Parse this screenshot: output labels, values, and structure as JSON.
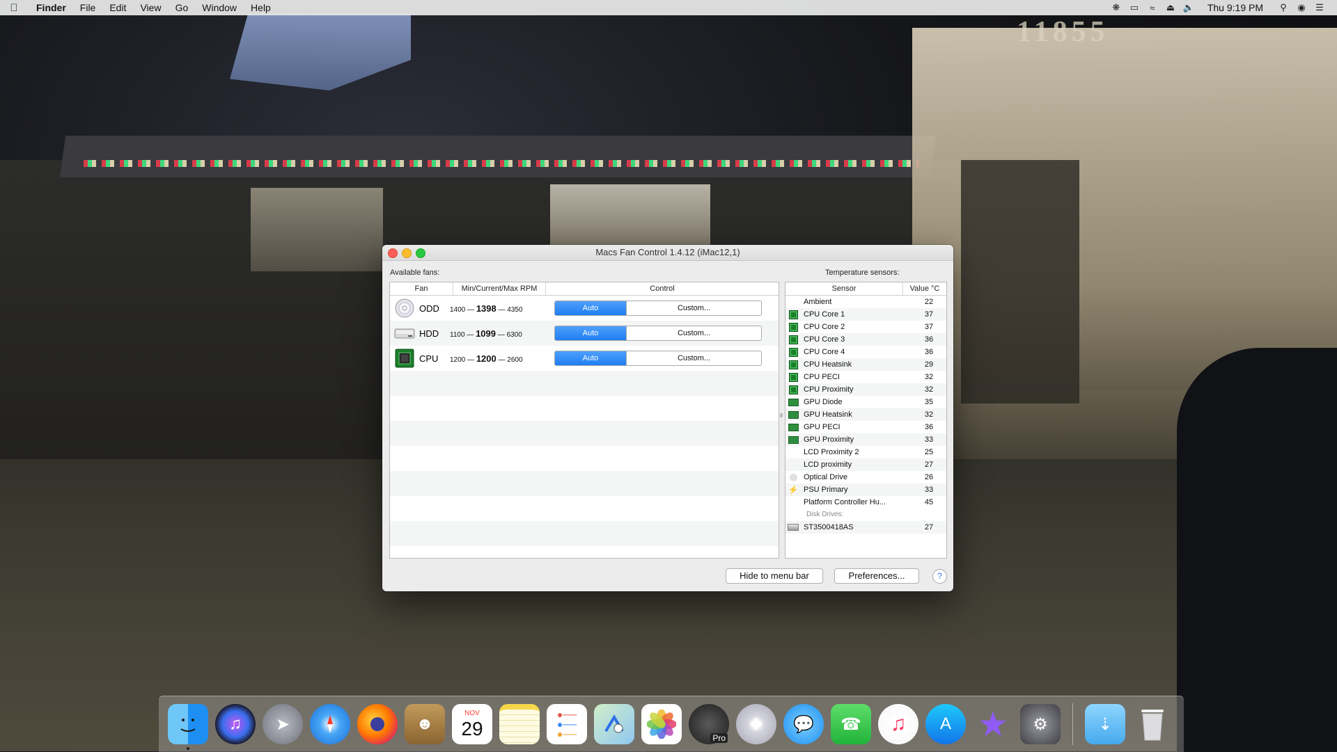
{
  "menubar": {
    "app_name": "Finder",
    "menus": [
      "File",
      "Edit",
      "View",
      "Go",
      "Window",
      "Help"
    ],
    "clock": "Thu 9:19 PM"
  },
  "window": {
    "title": "Macs Fan Control 1.4.12 (iMac12,1)",
    "fans_label": "Available fans:",
    "sensors_label": "Temperature sensors:",
    "fan_headers": {
      "fan": "Fan",
      "rpm": "Min/Current/Max RPM",
      "control": "Control"
    },
    "fans": [
      {
        "name": "ODD",
        "min": "1400",
        "current": "1398",
        "max": "4350",
        "auto": "Auto",
        "custom": "Custom...",
        "icon": "optical-drive-icon"
      },
      {
        "name": "HDD",
        "min": "1100",
        "current": "1099",
        "max": "6300",
        "auto": "Auto",
        "custom": "Custom...",
        "icon": "hard-drive-icon"
      },
      {
        "name": "CPU",
        "min": "1200",
        "current": "1200",
        "max": "2600",
        "auto": "Auto",
        "custom": "Custom...",
        "icon": "cpu-chip-icon"
      }
    ],
    "rpm_separator": "—",
    "sensor_headers": {
      "sensor": "Sensor",
      "value": "Value °C"
    },
    "sensors": [
      {
        "name": "Ambient",
        "value": "22",
        "icon": "none"
      },
      {
        "name": "CPU Core 1",
        "value": "37",
        "icon": "cpu"
      },
      {
        "name": "CPU Core 2",
        "value": "37",
        "icon": "cpu"
      },
      {
        "name": "CPU Core 3",
        "value": "36",
        "icon": "cpu"
      },
      {
        "name": "CPU Core 4",
        "value": "36",
        "icon": "cpu"
      },
      {
        "name": "CPU Heatsink",
        "value": "29",
        "icon": "cpu"
      },
      {
        "name": "CPU PECI",
        "value": "32",
        "icon": "cpu"
      },
      {
        "name": "CPU Proximity",
        "value": "32",
        "icon": "cpu"
      },
      {
        "name": "GPU Diode",
        "value": "35",
        "icon": "gpu"
      },
      {
        "name": "GPU Heatsink",
        "value": "32",
        "icon": "gpu"
      },
      {
        "name": "GPU PECI",
        "value": "36",
        "icon": "gpu"
      },
      {
        "name": "GPU Proximity",
        "value": "33",
        "icon": "gpu"
      },
      {
        "name": "LCD Proximity 2",
        "value": "25",
        "icon": "none"
      },
      {
        "name": "LCD proximity",
        "value": "27",
        "icon": "none"
      },
      {
        "name": "Optical Drive",
        "value": "26",
        "icon": "disc"
      },
      {
        "name": "PSU Primary",
        "value": "33",
        "icon": "bolt"
      },
      {
        "name": "Platform Controller Hu...",
        "value": "45",
        "icon": "none"
      }
    ],
    "disk_group_label": "Disk Drives:",
    "disks": [
      {
        "name": "ST3500418AS",
        "value": "27",
        "icon": "hdd"
      }
    ],
    "buttons": {
      "hide": "Hide to menu bar",
      "prefs": "Preferences...",
      "help": "?"
    }
  },
  "dock": {
    "calendar": {
      "month": "NOV",
      "day": "29"
    },
    "itunes_pro_label": "Pro"
  },
  "colors": {
    "accent": "#1f7ef2",
    "cpu_green": "#1b7e2a"
  }
}
